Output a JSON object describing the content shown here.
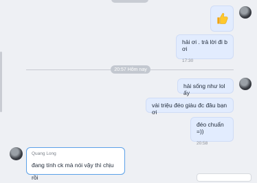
{
  "chat": {
    "divider_label": "20:57 Hôm nay",
    "messages": [
      {
        "text": "hải ơi . trả lời đi b ơi",
        "time": "17:30"
      },
      {
        "text": "hải sống như lol ấy"
      },
      {
        "text": "vài triệu đéo giàu đc đâu bạn ơi"
      },
      {
        "text": "đéo chuẩn =))",
        "time": "20:58"
      }
    ],
    "incoming": {
      "sender": "Quang Long",
      "text": "đang tính ck mà nói vậy thì chịu rồi"
    },
    "icons": {
      "sticker": "thumbs-up-icon"
    }
  }
}
